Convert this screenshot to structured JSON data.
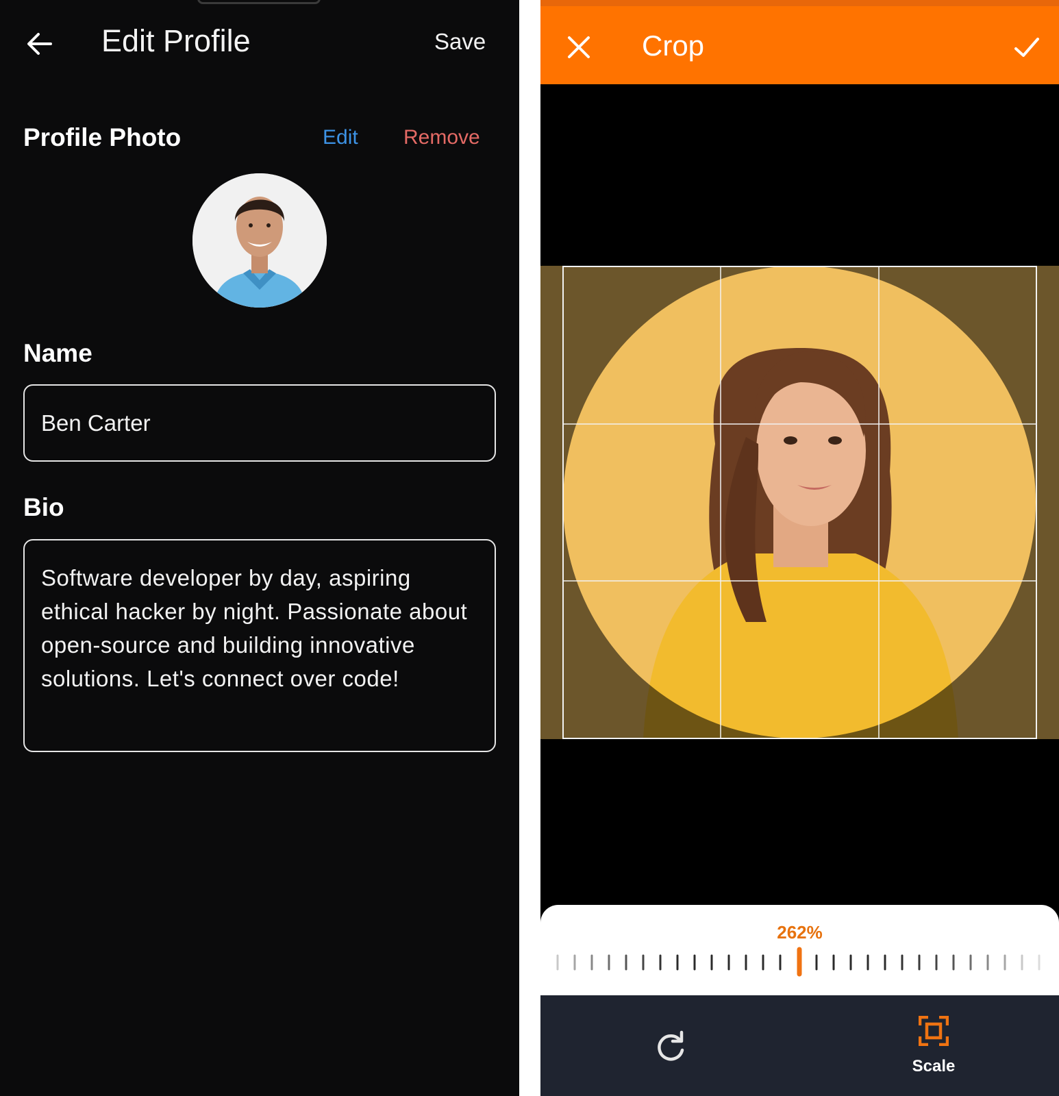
{
  "edit_profile": {
    "title": "Edit Profile",
    "save_label": "Save",
    "photo": {
      "label": "Profile Photo",
      "edit_label": "Edit",
      "remove_label": "Remove"
    },
    "name": {
      "label": "Name",
      "value": "Ben Carter"
    },
    "bio": {
      "label": "Bio",
      "value": "Software developer by day, aspiring ethical hacker by night. Passionate about open-source and building innovative solutions. Let's connect over code!"
    }
  },
  "crop": {
    "title": "Crop",
    "scale_percent": "262%",
    "scale_label": "Scale"
  },
  "colors": {
    "accent_orange": "#ff7300",
    "link_blue": "#3d93e6",
    "remove_red": "#e46a65",
    "bottom_bar": "#1f2430"
  }
}
